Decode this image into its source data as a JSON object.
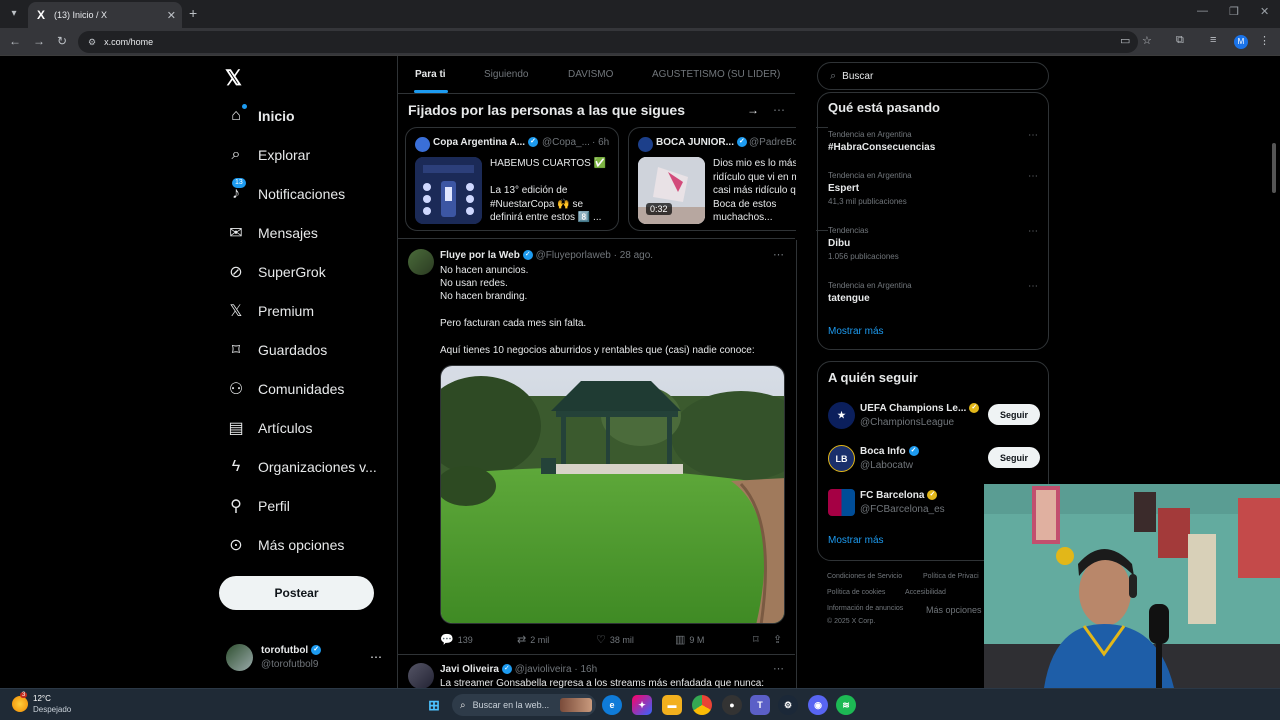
{
  "browser": {
    "tab_title": "(13) Inicio / X",
    "url": "x.com/home",
    "profile_initial": "M"
  },
  "sidebar": {
    "items": [
      {
        "label": "Inicio",
        "icon": "home-icon"
      },
      {
        "label": "Explorar",
        "icon": "search-icon"
      },
      {
        "label": "Notificaciones",
        "icon": "bell-icon",
        "badge": "13"
      },
      {
        "label": "Mensajes",
        "icon": "envelope-icon"
      },
      {
        "label": "SuperGrok",
        "icon": "grok-icon"
      },
      {
        "label": "Premium",
        "icon": "x-logo-icon"
      },
      {
        "label": "Guardados",
        "icon": "bookmark-icon"
      },
      {
        "label": "Comunidades",
        "icon": "people-icon"
      },
      {
        "label": "Artículos",
        "icon": "article-icon"
      },
      {
        "label": "Organizaciones v...",
        "icon": "lightning-icon"
      },
      {
        "label": "Perfil",
        "icon": "person-icon"
      },
      {
        "label": "Más opciones",
        "icon": "more-circle-icon"
      }
    ],
    "post_label": "Postear",
    "user": {
      "name": "torofutbol",
      "handle": "@torofutbol9"
    }
  },
  "timeline": {
    "tabs": [
      "Para ti",
      "Siguiendo",
      "DAVISMO",
      "AGUSTETISMO (SU LIDER)"
    ],
    "pinned_title": "Fijados por las personas a las que sigues",
    "pinned": [
      {
        "name": "Copa Argentina A...",
        "handle": "@Copa_...",
        "time": "· 6h",
        "text": "HABEMUS CUARTOS ✅\n\nLa 13° edición de\n#NuestarCopa 🙌 se\ndefinirá entre estos 8️⃣ ..."
      },
      {
        "name": "BOCA JUNIOR...",
        "handle": "@PadreBo",
        "text": "Dios mio es lo más\nridículo que vi en m\ncasi más ridículo q\nBoca de estos\nmuchachos...",
        "video_time": "0:32"
      }
    ],
    "tweet": {
      "name": "Fluye por la Web",
      "handle": "@Fluyeporlaweb",
      "time": "· 28 ago.",
      "lines": [
        "No hacen anuncios.",
        "No usan redes.",
        "No hacen branding.",
        "Pero facturan cada mes sin falta.",
        "Aquí tienes 10 negocios aburridos y rentables que (casi) nadie conoce:"
      ],
      "replies": "139",
      "reposts": "2 mil",
      "likes": "38 mil",
      "views": "9 M"
    },
    "tweet2": {
      "name": "Javi Oliveira",
      "handle": "@javioliveira",
      "time": "· 16h",
      "text": "La streamer Gonsabella regresa a los streams más enfadada que nunca:"
    }
  },
  "right": {
    "search_placeholder": "Buscar",
    "trends_title": "Qué está pasando",
    "trends": [
      {
        "context": "Tendencia en Argentina",
        "topic": "#HabraConsecuencias",
        "posts": ""
      },
      {
        "context": "Tendencia en Argentina",
        "topic": "Espert",
        "posts": "41,3 mil publicaciones"
      },
      {
        "context": "Tendencias",
        "topic": "Dibu",
        "posts": "1.056 publicaciones"
      },
      {
        "context": "Tendencia en Argentina",
        "topic": "tatengue",
        "posts": ""
      }
    ],
    "show_more": "Mostrar más",
    "follow_title": "A quién seguir",
    "follow": [
      {
        "name": "UEFA Champions Le...",
        "handle": "@ChampionsLeague",
        "button": "Seguir"
      },
      {
        "name": "Boca Info",
        "handle": "@Labocatw",
        "button": "Seguir"
      },
      {
        "name": "FC Barcelona",
        "handle": "@FCBarcelona_es",
        "button": ""
      }
    ],
    "follow_show_more": "Mostrar más",
    "footer": [
      "Condiciones de Servicio",
      "Política de Privaci",
      "Política de cookies",
      "Accesibilidad",
      "Información de anuncios",
      "Más opciones",
      "© 2025 X Corp."
    ]
  },
  "taskbar": {
    "temp": "12°C",
    "weather": "Despejado",
    "weather_badge": "3",
    "search_placeholder": "Buscar en la web..."
  }
}
